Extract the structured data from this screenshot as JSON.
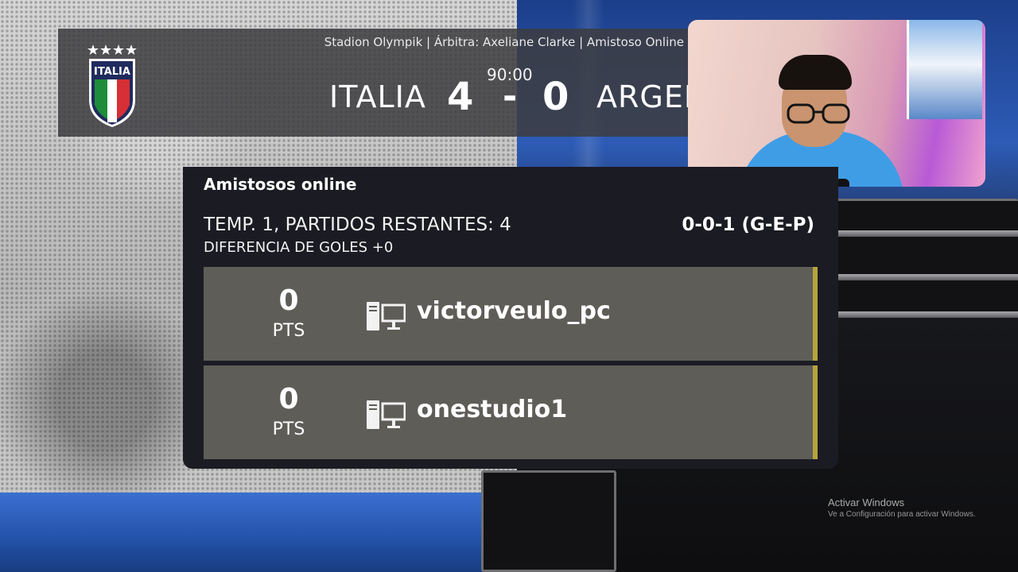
{
  "scoreboard": {
    "crest_text": "ITALIA",
    "match_info": "Stadion Olympik | Árbitra: Axeliane Clarke | Amistoso Online",
    "time": "90:00",
    "home_team": "ITALIA",
    "home_score": "4",
    "separator": "-",
    "away_score": "0",
    "away_team": "ARGEN"
  },
  "panel": {
    "title": "Amistosos online",
    "season": "TEMP. 1, PARTIDOS RESTANTES: 4",
    "goal_diff": "DIFERENCIA DE GOLES +0",
    "record": "0-0-1 (G-E-P)",
    "players": [
      {
        "points": "0",
        "points_label": "PTS",
        "platform_icon": "pc-icon",
        "name": "victorveulo_pc"
      },
      {
        "points": "0",
        "points_label": "PTS",
        "platform_icon": "pc-icon",
        "name": "onestudio1"
      }
    ]
  },
  "watermark": {
    "title": "Activar Windows",
    "subtitle": "Ve a Configuración para activar Windows."
  },
  "colors": {
    "panel_bg": "#1b1b23",
    "row_bg": "#5e5d58",
    "row_accent": "#b8a33a",
    "scoreboard_bg": "#3c3c40"
  }
}
